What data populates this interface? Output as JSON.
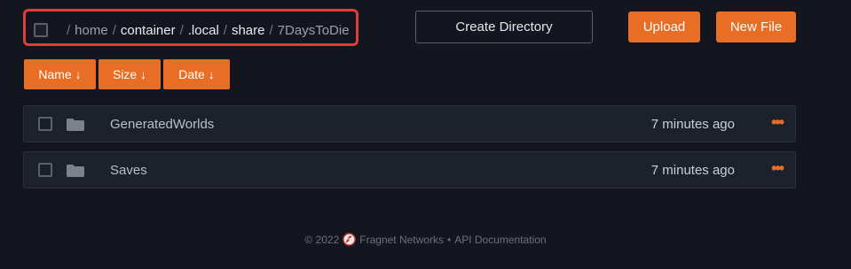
{
  "breadcrumb": {
    "parts": [
      {
        "label": "home",
        "style": "dim"
      },
      {
        "label": "container",
        "style": "link"
      },
      {
        "label": ".local",
        "style": "link"
      },
      {
        "label": "share",
        "style": "link"
      },
      {
        "label": "7DaysToDie",
        "style": "dim"
      }
    ],
    "separator": "/"
  },
  "toolbar": {
    "create_directory_label": "Create Directory",
    "upload_label": "Upload",
    "new_file_label": "New File"
  },
  "sort": {
    "name_label": "Name ↓",
    "size_label": "Size ↓",
    "date_label": "Date ↓"
  },
  "files": [
    {
      "name": "GeneratedWorlds",
      "modified": "7 minutes ago",
      "icon": "folder-icon",
      "menu": "•••"
    },
    {
      "name": "Saves",
      "modified": "7 minutes ago",
      "icon": "folder-icon",
      "menu": "•••"
    }
  ],
  "footer": {
    "copyright": "© 2022",
    "brand": "Fragnet Networks",
    "bullet": "•",
    "api_link": "API Documentation"
  },
  "colors": {
    "accent": "#e86d25",
    "highlight_border": "#e03c3c",
    "background": "#13161f",
    "row_background": "#1d212c"
  }
}
